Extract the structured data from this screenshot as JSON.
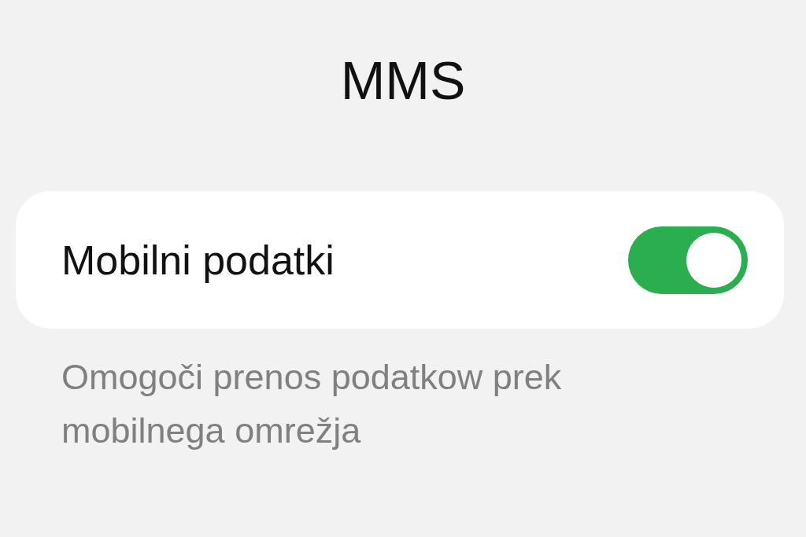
{
  "title": "MMS",
  "setting": {
    "label": "Mobilni podatki",
    "on": true
  },
  "description": "Omogoči prenos podatkow prek mobilnega omrežja"
}
